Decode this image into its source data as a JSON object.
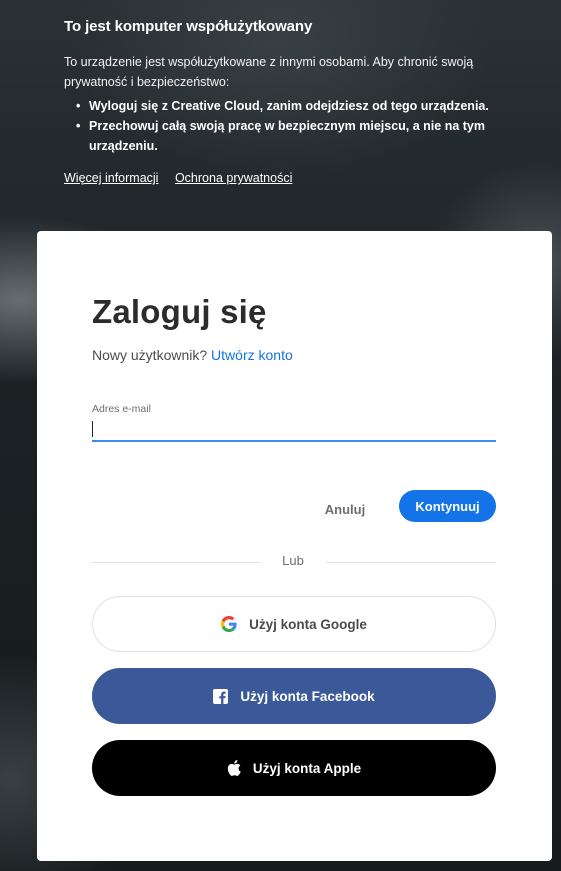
{
  "notice": {
    "title": "To jest komputer współużytkowany",
    "text": "To urządzenie jest współużytkowane z innymi osobami. Aby chronić swoją prywatność i bezpieczeństwo:",
    "items": [
      "Wyloguj się z Creative Cloud, zanim odejdziesz od tego urządzenia.",
      "Przechowuj całą swoją pracę w bezpiecznym miejscu, a nie na tym urządzeniu."
    ],
    "links": {
      "more_info": "Więcej informacji",
      "privacy": "Ochrona prywatności"
    }
  },
  "signin": {
    "heading": "Zaloguj się",
    "new_user_text": "Nowy użytkownik?",
    "create_account": "Utwórz konto",
    "email_label": "Adres e-mail",
    "email_value": "",
    "cancel_label": "Anuluj",
    "continue_label": "Kontynuuj",
    "divider_text": "Lub",
    "google_label": "Użyj konta Google",
    "facebook_label": "Użyj konta Facebook",
    "apple_label": "Użyj konta Apple"
  },
  "icons": {
    "google": "google-icon",
    "facebook": "facebook-icon",
    "apple": "apple-icon"
  },
  "colors": {
    "accent": "#1473e6",
    "facebook": "#3b5998",
    "apple": "#000000"
  }
}
